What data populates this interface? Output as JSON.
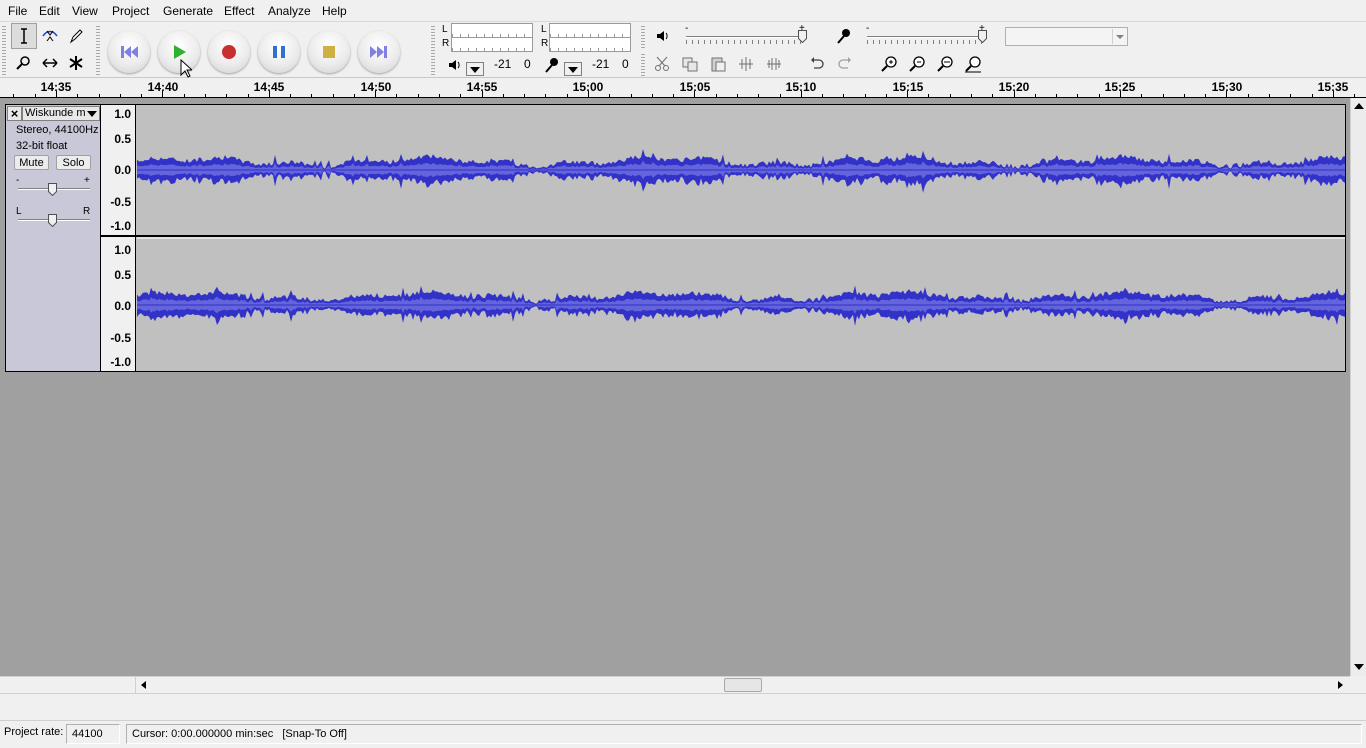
{
  "menu": [
    "File",
    "Edit",
    "View",
    "Project",
    "Generate",
    "Effect",
    "Analyze",
    "Help"
  ],
  "meters": {
    "playback": {
      "l": "L",
      "r": "R",
      "min_label": "-21",
      "max_label": "0"
    },
    "record": {
      "l": "L",
      "r": "R",
      "min_label": "-21",
      "max_label": "0"
    }
  },
  "mixer": {
    "minus": "-",
    "plus": "+",
    "in_minus": "-",
    "in_plus": "+"
  },
  "ruler": {
    "labels": [
      "14:35",
      "14:40",
      "14:45",
      "14:50",
      "14:55",
      "15:00",
      "15:05",
      "15:10",
      "15:15",
      "15:20",
      "15:25",
      "15:30",
      "15:35"
    ]
  },
  "track": {
    "close": "×",
    "name": "Wiskunde m",
    "format": "Stereo, 44100Hz",
    "bit_depth": "32-bit float",
    "mute": "Mute",
    "solo": "Solo",
    "gain_minus": "-",
    "gain_plus": "+",
    "pan_left": "L",
    "pan_right": "R",
    "scale": [
      "1.0",
      "0.5",
      "0.0",
      "-0.5",
      "-1.0"
    ],
    "waveform_color": "#3232c8",
    "waveform_rms_color": "#6464dc"
  },
  "status": {
    "project_rate_label": "Project rate:",
    "project_rate_value": "44100",
    "cursor": "Cursor: 0:00.000000 min:sec",
    "snap": "[Snap-To Off]"
  }
}
